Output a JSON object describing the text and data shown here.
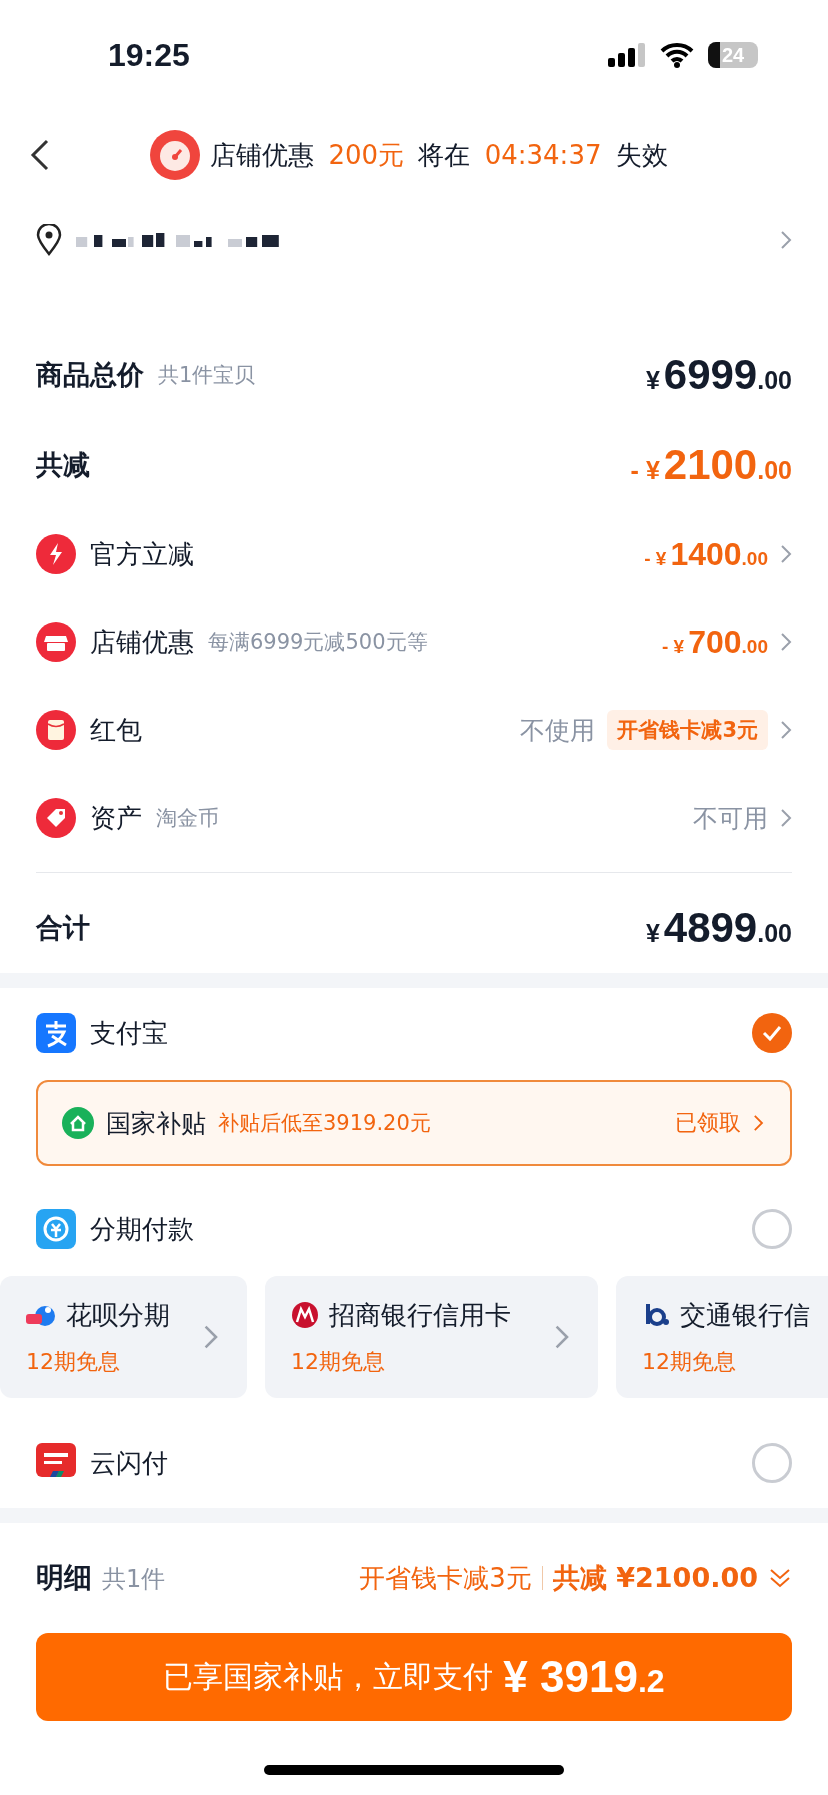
{
  "status_bar": {
    "time": "19:25",
    "battery": "24"
  },
  "header": {
    "segments": [
      {
        "text": "店铺优惠",
        "highlight": false
      },
      {
        "text": "200元",
        "highlight": true
      },
      {
        "text": "将在",
        "highlight": false
      },
      {
        "text": "04:34:37",
        "highlight": true
      },
      {
        "text": "失效",
        "highlight": false
      }
    ]
  },
  "summary": [
    {
      "kind": "subtotal",
      "label": "商品总价",
      "note": "共1件宝贝",
      "amount": {
        "currency": "¥",
        "integer": "6999",
        "decimal": ".00"
      }
    },
    {
      "kind": "reduction",
      "label": "共减",
      "amount": {
        "sign": "-",
        "currency": "¥",
        "integer": "2100",
        "decimal": ".00"
      }
    }
  ],
  "discounts": [
    {
      "label": "官方立减",
      "amount": {
        "sign": "-",
        "currency": "¥",
        "integer": "1400",
        "decimal": ".00"
      }
    },
    {
      "label": "店铺优惠",
      "note": "每满6999元减500元等",
      "amount": {
        "sign": "-",
        "currency": "¥",
        "integer": "700",
        "decimal": ".00"
      }
    },
    {
      "label": "红包",
      "value": "不使用",
      "badge": "开省钱卡减3元"
    },
    {
      "label": "资产",
      "note": "淘金币",
      "value": "不可用"
    }
  ],
  "total": {
    "label": "合计",
    "amount": {
      "currency": "¥",
      "integer": "4899",
      "decimal": ".00"
    }
  },
  "payment_methods": [
    {
      "kind": "alipay",
      "label": "支付宝",
      "selected": true,
      "subsidy": {
        "title": "国家补贴",
        "text": "补贴后低至3919.20元",
        "action": "已领取"
      }
    },
    {
      "kind": "installment",
      "label": "分期付款",
      "selected": false,
      "plans": [
        {
          "name": "花呗分期",
          "terms": "12期免息"
        },
        {
          "name": "招商银行信用卡",
          "terms": "12期免息"
        },
        {
          "name": "交通银行信",
          "terms": "12期免息"
        }
      ]
    },
    {
      "kind": "unionpay",
      "label": "云闪付",
      "selected": false
    }
  ],
  "footer": {
    "title": "明细",
    "count": "共1件",
    "promo": "开省钱卡减3元",
    "saving_label": "共减",
    "saving": "¥2100.00"
  },
  "pay_button": {
    "text": "已享国家补贴，立即支付",
    "currency": "¥",
    "integer": "3919",
    "decimal": ".2"
  }
}
